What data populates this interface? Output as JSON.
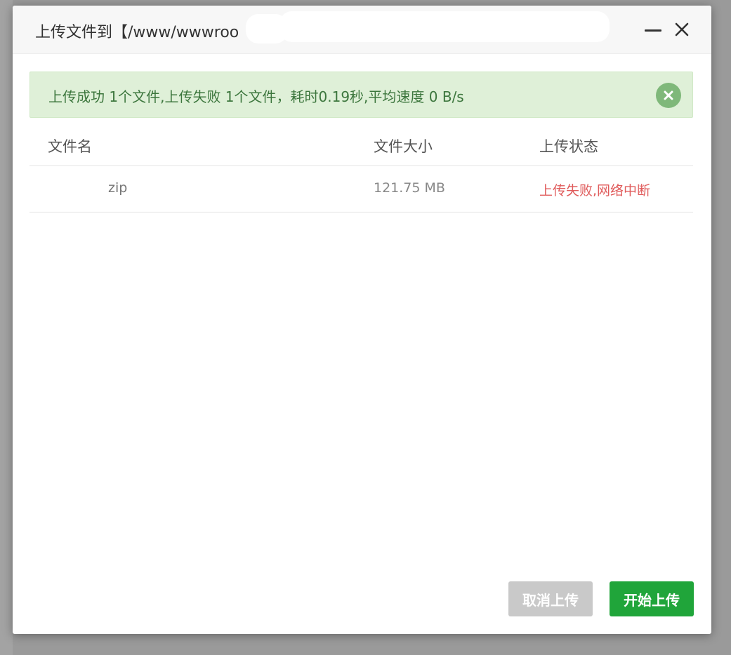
{
  "dialog": {
    "title": "上传文件到【/www/wwwroo"
  },
  "alert": {
    "message": "上传成功 1个文件,上传失败 1个文件，耗时0.19秒,平均速度 0 B/s",
    "bg_color": "#dff0d8",
    "text_color": "#3c763d"
  },
  "table": {
    "headers": {
      "name": "文件名",
      "size": "文件大小",
      "status": "上传状态"
    },
    "rows": [
      {
        "name": "zip",
        "size": "121.75 MB",
        "status": "上传失败,网络中断"
      }
    ]
  },
  "footer": {
    "cancel_label": "取消上传",
    "start_label": "开始上传"
  },
  "colors": {
    "accent": "#20a53a",
    "error": "#e05b5b",
    "disabled": "#c9c9c9"
  },
  "icons": {
    "minimize": "minimize-icon",
    "close": "close-icon",
    "alert_close": "circle-close-icon"
  }
}
